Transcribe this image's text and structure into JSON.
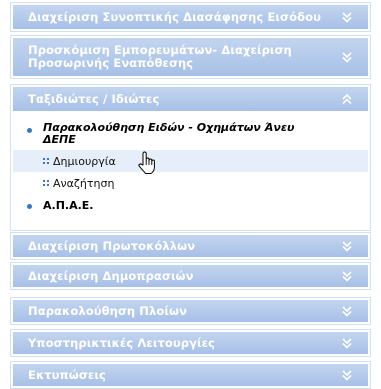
{
  "sections": [
    {
      "label": "Διαχείριση Συνοπτικής Διασάφησης Εισόδου",
      "icon": "chevron-down-icon"
    },
    {
      "label": "Προσκόμιση Εμπορευμάτων- Διαχείριση Προσωρινής Εναπόθεσης",
      "icon": "chevron-down-icon"
    },
    {
      "label": "Ταξιδιώτες / Ιδιώτες",
      "icon": "chevron-up-icon"
    },
    {
      "label": "Διαχείριση Πρωτοκόλλων",
      "icon": "chevron-down-icon"
    },
    {
      "label": "Διαχείριση Δημοπρασιών",
      "icon": "chevron-down-icon"
    },
    {
      "label": "Παρακολούθηση Πλοίων",
      "icon": "chevron-down-icon"
    },
    {
      "label": "Υποστηρικτικές Λειτουργίες",
      "icon": "chevron-down-icon"
    },
    {
      "label": "Εκτυπώσεις",
      "icon": "chevron-down-icon"
    }
  ],
  "travellers": {
    "item1_line1": "Παρακολούθηση Ειδών - Οχημάτων Άνευ",
    "item1_line2": "ΔΕΠΕ",
    "sub_create": "Δημιουργία",
    "sub_search": "Αναζήτηση",
    "item2": "Α.Π.Α.Ε."
  },
  "colors": {
    "header": "#a7c0e7",
    "bullet": "#3478c8",
    "highlight": "#e5eef9"
  }
}
